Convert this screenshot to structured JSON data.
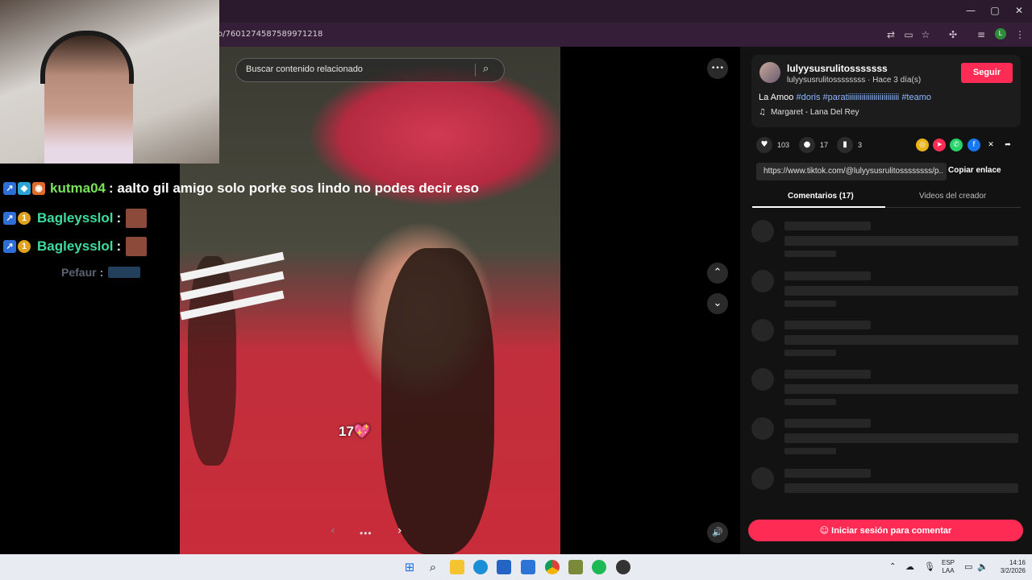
{
  "browser": {
    "url": "o/7601274587589971218",
    "window_controls": {
      "minimize": "—",
      "maximize": "▢",
      "close": "✕"
    },
    "profile_initial": "L"
  },
  "video": {
    "search_placeholder": "Buscar contenido relacionado",
    "sticker_text": "17💖",
    "more_icon": "•••",
    "nav_prev": "‹",
    "nav_next": "›",
    "dots": "•••"
  },
  "chat": [
    {
      "user": "",
      "message": "",
      "user_color": "#7fd25a"
    },
    {
      "user": "kutma04",
      "message": ": aalto gil amigo solo porke sos lindo no podes decir eso",
      "user_color": "#7be35b"
    },
    {
      "user": "Bagleysslol",
      "message": ":",
      "user_color": "#3fdba0"
    },
    {
      "user": "Bagleysslol",
      "message": ":",
      "user_color": "#3fdba0"
    },
    {
      "user": "Pefaur",
      "message": ":",
      "user_color": "#7d8aa3"
    }
  ],
  "post": {
    "username": "lulyysusrulitosssssss",
    "subline": "lulyysusrulitossssssss · Hace 3 día(s)",
    "follow_label": "Seguir",
    "caption_text": "La Amoo",
    "hashtags": [
      "#doris",
      "#paratiiiiiiiiiiiiiiiiiiiiiiiiii",
      "#teamo"
    ],
    "music": "Margaret - Lana Del Rey",
    "likes": "103",
    "comments": "17",
    "saves": "3",
    "link": "https://www.tiktok.com/@lulyysusrulitossssssss/p...",
    "copy_label": "Copiar enlace",
    "tab_comments": "Comentarios (17)",
    "tab_videos": "Videos del creador",
    "login_label": "Iniciar sesión para comentar"
  },
  "tray": {
    "lang_top": "ESP",
    "lang_bottom": "LAA",
    "time": "14:16",
    "date": "3/2/2026"
  },
  "colors": {
    "accent": "#fe2c55",
    "panel": "#121212",
    "hashtag": "#8fb7ff"
  }
}
